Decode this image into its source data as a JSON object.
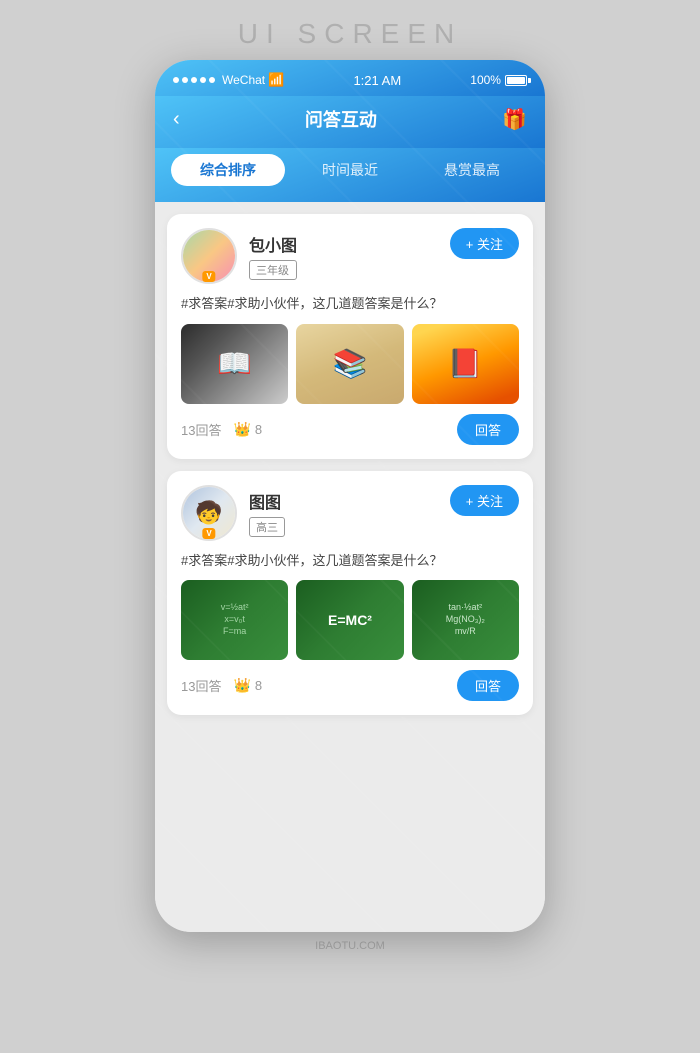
{
  "page": {
    "screen_title": "UI SCREEN",
    "bottom_label": "IBAOTU.COM"
  },
  "status_bar": {
    "dots_count": 5,
    "app_name": "WeChat",
    "wifi_symbol": "⊙",
    "time": "1:21 AM",
    "battery_pct": "100%"
  },
  "top_bar": {
    "back_icon": "‹",
    "title": "问答互动",
    "gift_icon": "🎁"
  },
  "filter_tabs": [
    {
      "label": "综合排序",
      "active": true
    },
    {
      "label": "时间最近",
      "active": false
    },
    {
      "label": "悬赏最高",
      "active": false
    }
  ],
  "cards": [
    {
      "id": "card-1",
      "username": "包小图",
      "grade": "三年级",
      "v_badge": "V",
      "follow_label": "+ 关注",
      "question": "#求答案#求助小伙伴，这几道题答案是什么？",
      "images": [
        "book-open",
        "book-stack",
        "colorful-books"
      ],
      "reply_count": "13回答",
      "reward": "8",
      "answer_label": "回答"
    },
    {
      "id": "card-2",
      "username": "图图",
      "grade": "高三",
      "v_badge": "V",
      "follow_label": "+ 关注",
      "question": "#求答案#求助小伙伴，这几道题答案是什么？",
      "images": [
        "math-board-1",
        "math-formula",
        "math-board-2"
      ],
      "reply_count": "13回答",
      "reward": "8",
      "answer_label": "回答"
    }
  ]
}
